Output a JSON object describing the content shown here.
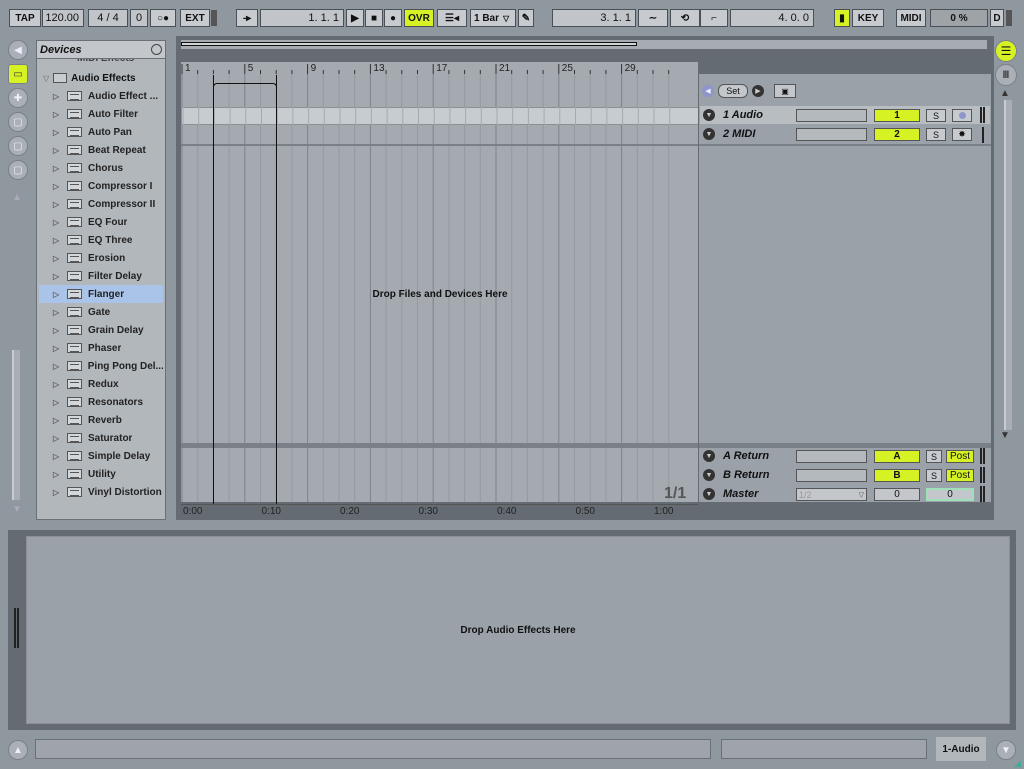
{
  "transport": {
    "tap": "TAP",
    "tempo": "120.00",
    "signature": "4 / 4",
    "quantize_count": "0",
    "ext": "EXT",
    "arrangement_position": "1.   1.   1",
    "ovr": "OVR",
    "quantize_menu": "1 Bar",
    "loop_start": "3.   1.   1",
    "loop_length": "4.   0.   0",
    "key": "KEY",
    "midi": "MIDI",
    "cpu": "0 %",
    "disk": "D"
  },
  "browser": {
    "title": "Devices",
    "partial_item": "MIDI Effects",
    "folder": "Audio Effects",
    "items": [
      "Audio Effect ...",
      "Auto Filter",
      "Auto Pan",
      "Beat Repeat",
      "Chorus",
      "Compressor I",
      "Compressor II",
      "EQ Four",
      "EQ Three",
      "Erosion",
      "Filter Delay",
      "Flanger",
      "Gate",
      "Grain Delay",
      "Phaser",
      "Ping Pong Del...",
      "Redux",
      "Resonators",
      "Reverb",
      "Saturator",
      "Simple Delay",
      "Utility",
      "Vinyl Distortion"
    ],
    "selected_index": 11
  },
  "arrangement": {
    "bar_labels": [
      "1",
      "5",
      "9",
      "13",
      "17",
      "21",
      "25",
      "29"
    ],
    "time_labels": [
      "0:00",
      "0:10",
      "0:20",
      "0:30",
      "0:40",
      "0:50",
      "1:00"
    ],
    "drop_text": "Drop Files and Devices Here",
    "page_indicator": "1/1",
    "set_button": "Set"
  },
  "tracks": [
    {
      "name": "1 Audio",
      "number": "1",
      "solo": "S"
    },
    {
      "name": "2 MIDI",
      "number": "2",
      "solo": "S"
    }
  ],
  "returns": [
    {
      "name": "A Return",
      "letter": "A",
      "solo": "S",
      "post": "Post"
    },
    {
      "name": "B Return",
      "letter": "B",
      "solo": "S",
      "post": "Post"
    }
  ],
  "master": {
    "name": "Master",
    "cue": "1/2",
    "volume": "0",
    "pan": "0"
  },
  "detail": {
    "drop_text": "Drop Audio Effects Here"
  },
  "status": {
    "selected_track": "1-Audio"
  },
  "colors": {
    "accent": "#d6f224",
    "selection": "#a9c4e8",
    "panel": "#9aa1a8"
  }
}
